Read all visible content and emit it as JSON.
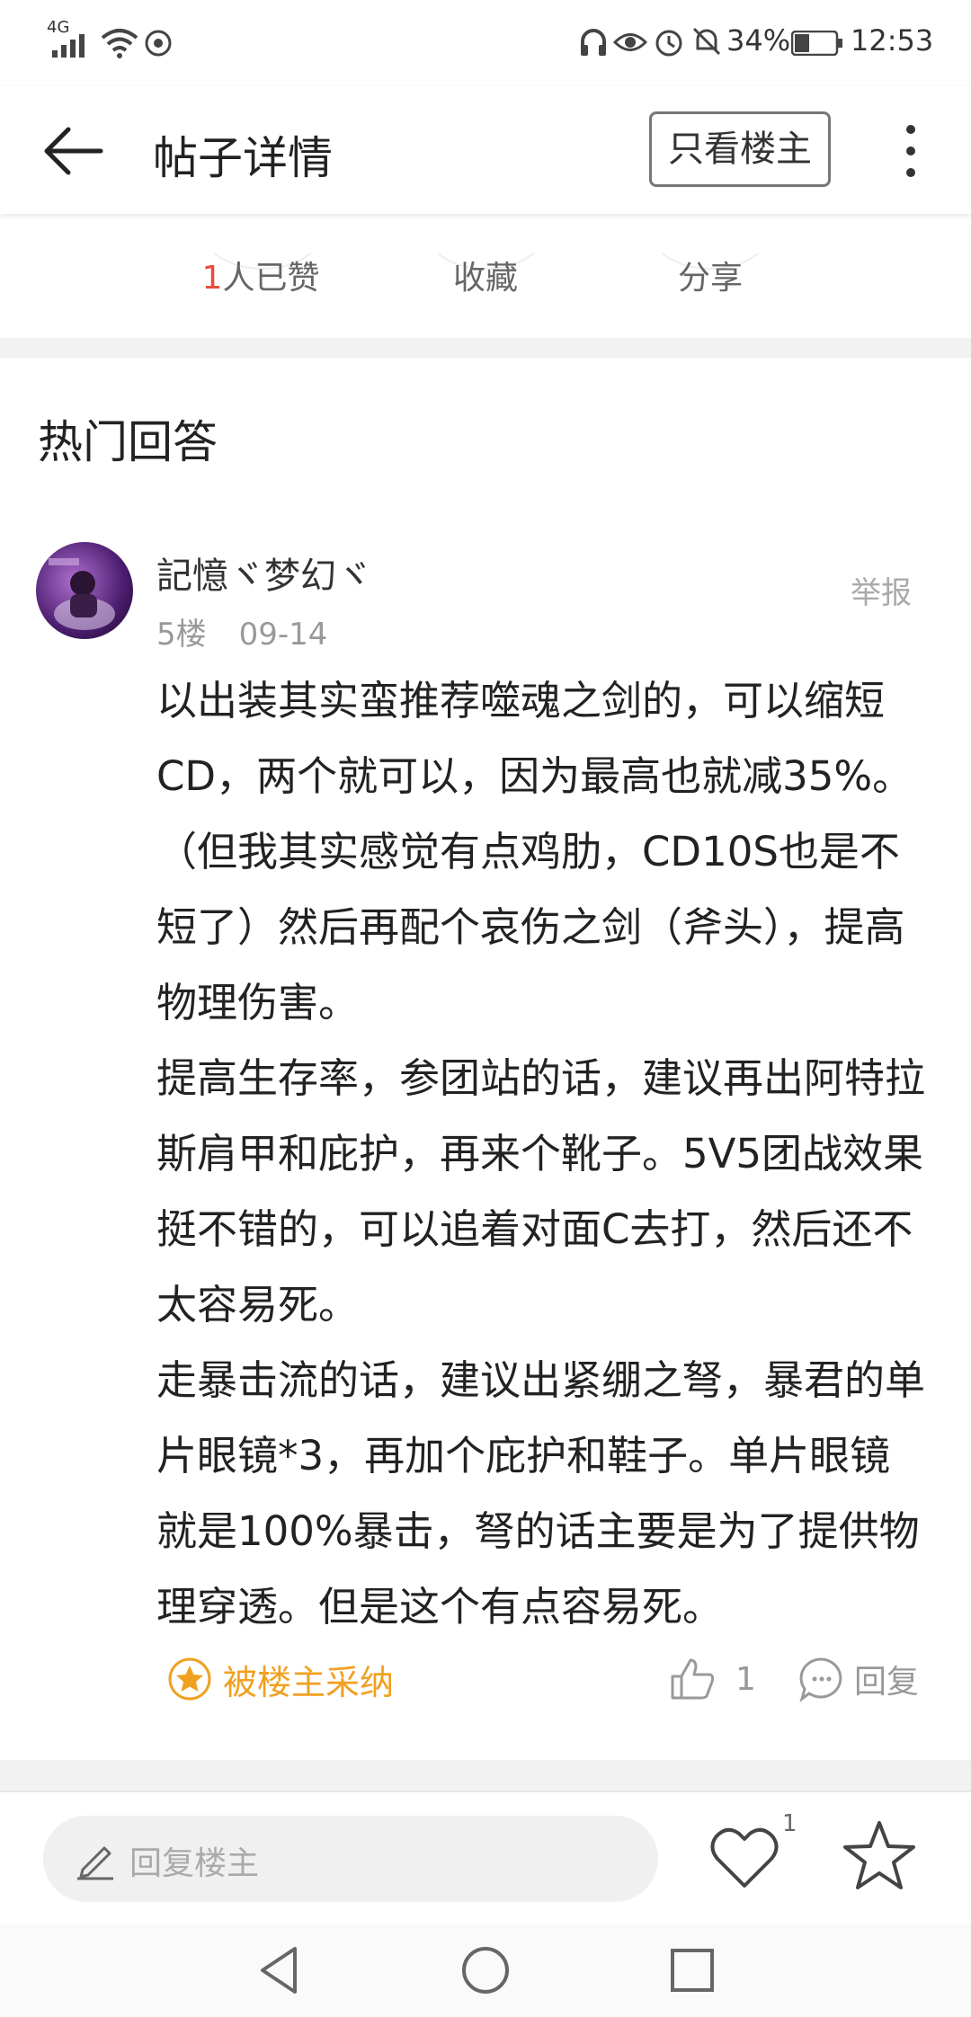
{
  "status_bar": {
    "network": "4G",
    "battery": "34%",
    "time": "12:53"
  },
  "header": {
    "title": "帖子详情",
    "only_op_label": "只看楼主"
  },
  "actions": {
    "likes_count": "1",
    "likes_suffix": "人已赞",
    "favorite_label": "收藏",
    "share_label": "分享"
  },
  "hot_section": {
    "title": "热门回答",
    "answer": {
      "username": "記憶ヾ梦幻ヾ",
      "report_label": "举报",
      "floor": "5楼",
      "date": "09-14",
      "paragraphs": [
        "以出装其实蛮推荐噬魂之剑的，可以缩短CD，两个就可以，因为最高也就减35%。（但我其实感觉有点鸡肋，CD10S也是不短了）然后再配个哀伤之剑（斧头），提高物理伤害。",
        "提高生存率，参团站的话，建议再出阿特拉斯肩甲和庇护，再来个靴子。5V5团战效果挺不错的，可以追着对面C去打，然后还不太容易死。",
        "走暴击流的话，建议出紧绷之弩，暴君的单片眼镜*3，再加个庇护和鞋子。单片眼镜就是100%暴击，弩的话主要是为了提供物理穿透。但是这个有点容易死。"
      ],
      "adopted_label": "被楼主采纳",
      "like_count": "1",
      "reply_label": "回复"
    }
  },
  "bottom_bar": {
    "reply_placeholder": "回复楼主",
    "heart_count": "1"
  },
  "colors": {
    "accent_red": "#e74c3c",
    "adopted_orange": "#f0a020"
  }
}
